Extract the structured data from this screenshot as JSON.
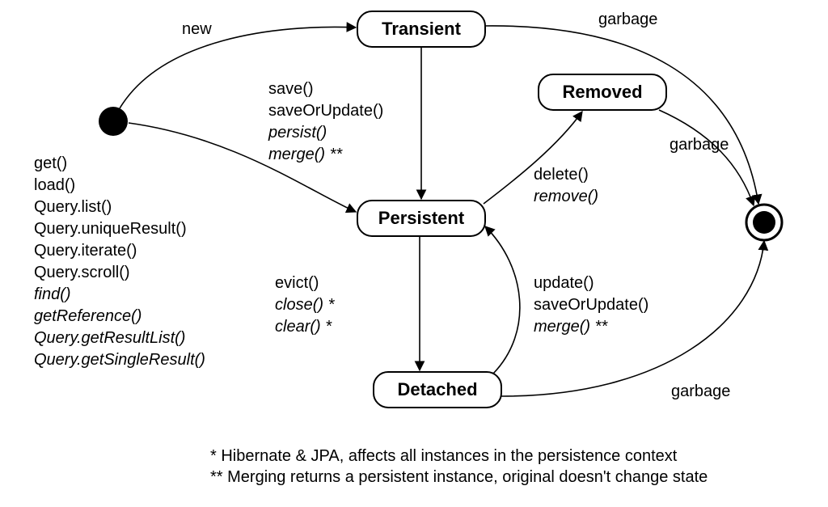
{
  "states": {
    "transient": "Transient",
    "persistent": "Persistent",
    "detached": "Detached",
    "removed": "Removed"
  },
  "edges": {
    "new": "new",
    "garbage_transient": "garbage",
    "garbage_removed": "garbage",
    "garbage_detached": "garbage",
    "transient_to_persistent": [
      {
        "t": "save()",
        "i": false
      },
      {
        "t": "saveOrUpdate()",
        "i": false
      },
      {
        "t": "persist()",
        "i": true
      },
      {
        "t": "merge() **",
        "i": true
      }
    ],
    "initial_to_persistent": [
      {
        "t": "get()",
        "i": false
      },
      {
        "t": "load()",
        "i": false
      },
      {
        "t": "Query.list()",
        "i": false
      },
      {
        "t": "Query.uniqueResult()",
        "i": false
      },
      {
        "t": "Query.iterate()",
        "i": false
      },
      {
        "t": "Query.scroll()",
        "i": false
      },
      {
        "t": "find()",
        "i": true
      },
      {
        "t": "getReference()",
        "i": true
      },
      {
        "t": "Query.getResultList()",
        "i": true
      },
      {
        "t": "Query.getSingleResult()",
        "i": true
      }
    ],
    "persistent_to_removed": [
      {
        "t": "delete()",
        "i": false
      },
      {
        "t": "remove()",
        "i": true
      }
    ],
    "persistent_to_detached": [
      {
        "t": "evict()",
        "i": false
      },
      {
        "t": "close() *",
        "i": true
      },
      {
        "t": "clear() *",
        "i": true
      }
    ],
    "detached_to_persistent": [
      {
        "t": "update()",
        "i": false
      },
      {
        "t": "saveOrUpdate()",
        "i": false
      },
      {
        "t": "merge() **",
        "i": true
      }
    ]
  },
  "footnotes": {
    "star": "* Hibernate & JPA, affects all instances in the persistence context",
    "dstar": "** Merging returns a persistent instance, original doesn't change state"
  }
}
